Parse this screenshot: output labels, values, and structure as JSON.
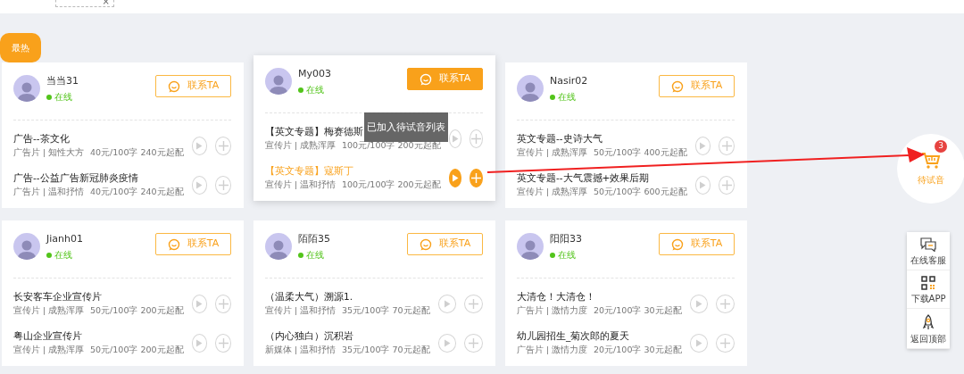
{
  "top_bar": {
    "tag_close": "×"
  },
  "tabs": [
    {
      "label": "最热",
      "selected": true
    }
  ],
  "cards": [
    {
      "name": "当当31",
      "status": "在线",
      "online": true,
      "contact": "联系TA",
      "highlighted": false,
      "items": [
        {
          "title": "广告--茶文化",
          "tags": "广告片 | 知性大方",
          "price": "40元/100字 240元起配",
          "active": false
        },
        {
          "title": "广告--公益广告新冠肺炎疫情",
          "tags": "广告片 | 温和抒情",
          "price": "40元/100字 240元起配",
          "active": false
        }
      ]
    },
    {
      "name": "My003",
      "status": "在线",
      "online": true,
      "contact": "联系TA",
      "highlighted": true,
      "toast": "已加入待试音列表",
      "items": [
        {
          "title": "【英文专题】梅赛德斯",
          "tags": "宣传片 | 成熟浑厚",
          "price": "100元/100字 200元起配",
          "active": false
        },
        {
          "title": "【英文专题】寇斯丁",
          "tags": "宣传片 | 温和抒情",
          "price": "100元/100字 200元起配",
          "active": true
        }
      ]
    },
    {
      "name": "Nasir02",
      "status": "在线",
      "online": true,
      "contact": "联系TA",
      "highlighted": false,
      "items": [
        {
          "title": "英文专题--史诗大气",
          "tags": "宣传片 | 成熟浑厚",
          "price": "50元/100字 400元起配",
          "active": false
        },
        {
          "title": "英文专题--大气震撼+效果后期",
          "tags": "宣传片 | 成熟浑厚",
          "price": "50元/100字 600元起配",
          "active": false
        }
      ]
    },
    {
      "name": "Jianh01",
      "status": "在线",
      "online": true,
      "contact": "联系TA",
      "highlighted": false,
      "items": [
        {
          "title": "长安客车企业宣传片",
          "tags": "宣传片 | 成熟浑厚",
          "price": "50元/100字 200元起配",
          "active": false
        },
        {
          "title": "粤山企业宣传片",
          "tags": "宣传片 | 成熟浑厚",
          "price": "50元/100字 200元起配",
          "active": false
        }
      ]
    },
    {
      "name": "陌陌35",
      "status": "在线",
      "online": true,
      "contact": "联系TA",
      "highlighted": false,
      "items": [
        {
          "title": "（温柔大气）溯源1.",
          "tags": "宣传片 | 温和抒情",
          "price": "35元/100字 70元起配",
          "active": false
        },
        {
          "title": "（内心独白）沉积岩",
          "tags": "新媒体 | 温和抒情",
          "price": "35元/100字 70元起配",
          "active": false
        }
      ]
    },
    {
      "name": "阳阳33",
      "status": "在线",
      "online": true,
      "contact": "联系TA",
      "highlighted": false,
      "items": [
        {
          "title": "大清仓！大清仓！",
          "tags": "广告片 | 激情力度",
          "price": "20元/100字 30元起配",
          "active": false
        },
        {
          "title": "幼儿园招生_菊次郎的夏天",
          "tags": "广告片 | 激情力度",
          "price": "20元/100字 30元起配",
          "active": false
        }
      ]
    }
  ],
  "cart": {
    "count": "3",
    "label": "待试音"
  },
  "side_tools": [
    {
      "kind": "chat",
      "label": "在线客服"
    },
    {
      "kind": "qr",
      "label": "下载APP"
    },
    {
      "kind": "rocket",
      "label": "返回顶部"
    }
  ]
}
